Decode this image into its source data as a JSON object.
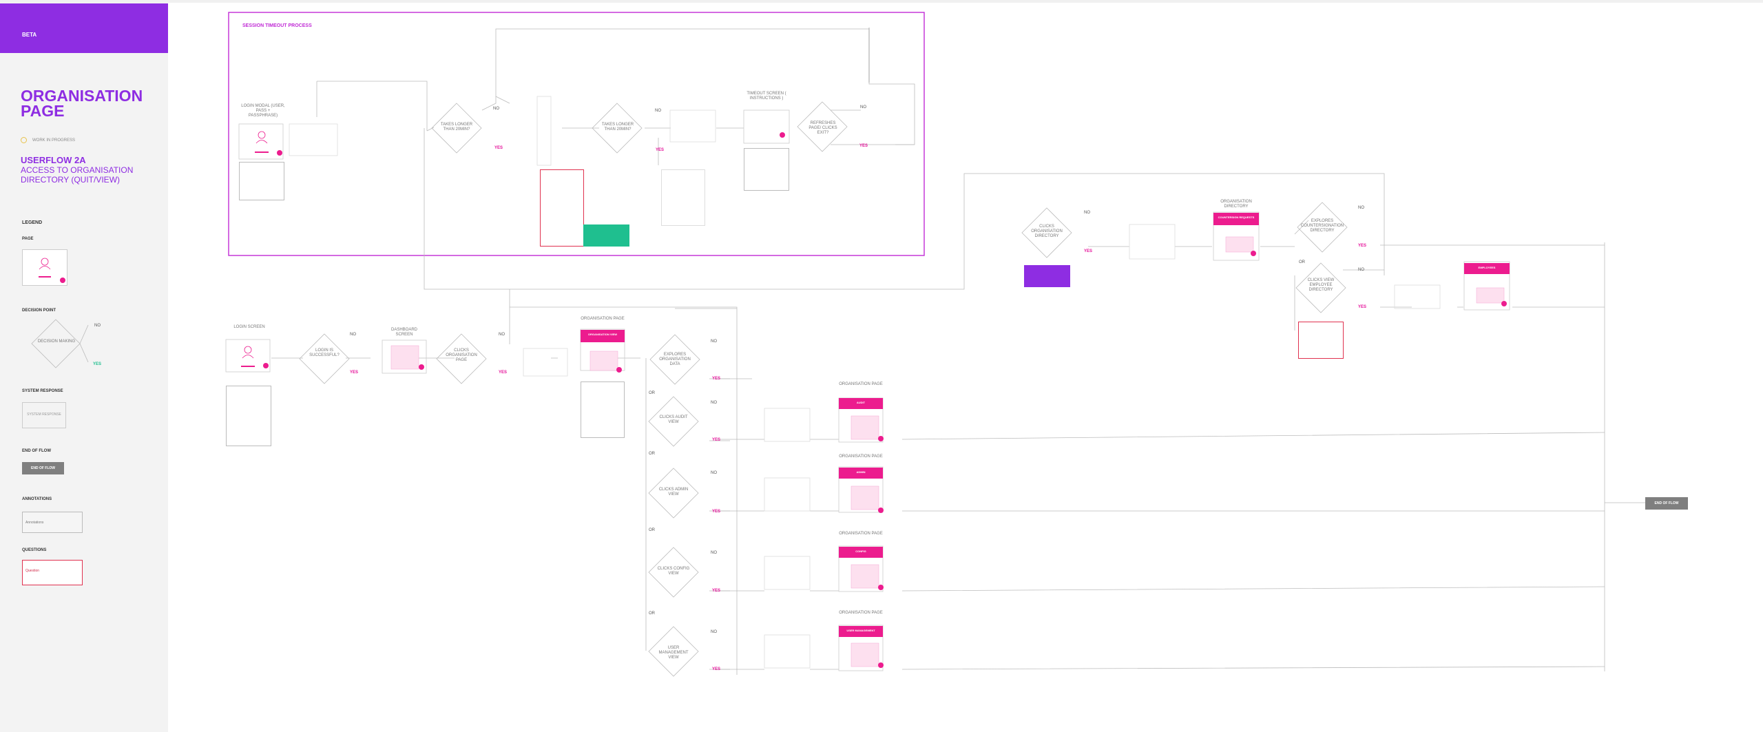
{
  "sidebar": {
    "beta": "BETA",
    "title": "ORGANISATION PAGE",
    "status": "WORK IN PROGRESS",
    "userflow": "USERFLOW 2A",
    "access": "ACCESS  TO ORGANISATION DIRECTORY (QUIT/VIEW)",
    "legend": "LEGEND",
    "page": "PAGE",
    "decision_point": "DECISION POINT",
    "decision_making": "DECISION MAKING",
    "system_response": "SYSTEM RESPONSE",
    "system_response_box": "SYSTEM RESPONSE",
    "end_of_flow": "END OF FLOW",
    "end_of_flow_box": "END OF FLOW",
    "annotations": "ANNOTATIONS",
    "annotations_box": "Annotations",
    "questions": "QUESTIONS",
    "questions_box": "Question",
    "no": "NO",
    "yes": "YES"
  },
  "session": {
    "title": "SESSION TIMEOUT PROCESS",
    "login_modal": "LOGIN MODAL (USER, PASS + PASSPHRASE)",
    "takes_longer_1": "TAKES LONGER THAN 20MIN?",
    "takes_longer_2": "TAKES LONGER THAN 20MIN?",
    "timeout_screen": "TIMEOUT SCREEN ( INSTRUCTIONS )",
    "refreshes": "REFRESHES PAGE/ CLICKS EXIT?",
    "no": "NO",
    "yes": "YES"
  },
  "main": {
    "login_screen": "LOGIN SCREEN",
    "login_successful": "LOGIN IS SUCCESSFUL?",
    "dashboard": "DASHBOARD SCREEN",
    "clicks_org_page": "CLICKS ORGANISATION PAGE",
    "organisation_page": "ORGANISATION PAGE",
    "organisation_view": "ORGANISATION VIEW",
    "explores_org_data": "EXPLORES ORGANISATION DATA",
    "clicks_audit": "CLICKS AUDIT VIEW",
    "clicks_admin": "CLICKS ADMIN VIEW",
    "clicks_config": "CLICKS CONFIG VIEW",
    "user_mgmt": "USER MANAGEMENT VIEW",
    "audit": "AUDIT",
    "admin": "ADMIN",
    "config": "CONFIG",
    "user_mgmt_pill": "USER MANAGEMENT",
    "clicks_org_dir": "CLICKS ORGANISATION DIRECTORY",
    "organisation_directory": "ORGANISATION DIRECTORY",
    "countersign_requests": "COUNTERSIGN REQUESTS",
    "explores_countersign": "EXPLORES COUNTERSIGNATION DIRECTORY",
    "clicks_view_employee": "CLICKS VIEW EMPLOYEE DIRECTORY",
    "employees": "EMPLOYEES",
    "end_of_flow": "END OF FLOW",
    "or": "OR",
    "no": "NO",
    "yes": "YES"
  },
  "colors": {
    "purple": "#8e2de2",
    "magenta": "#ec1c8e",
    "green": "#1fbf8f",
    "question_red": "#e0304e",
    "session_border": "#c12bd6"
  }
}
